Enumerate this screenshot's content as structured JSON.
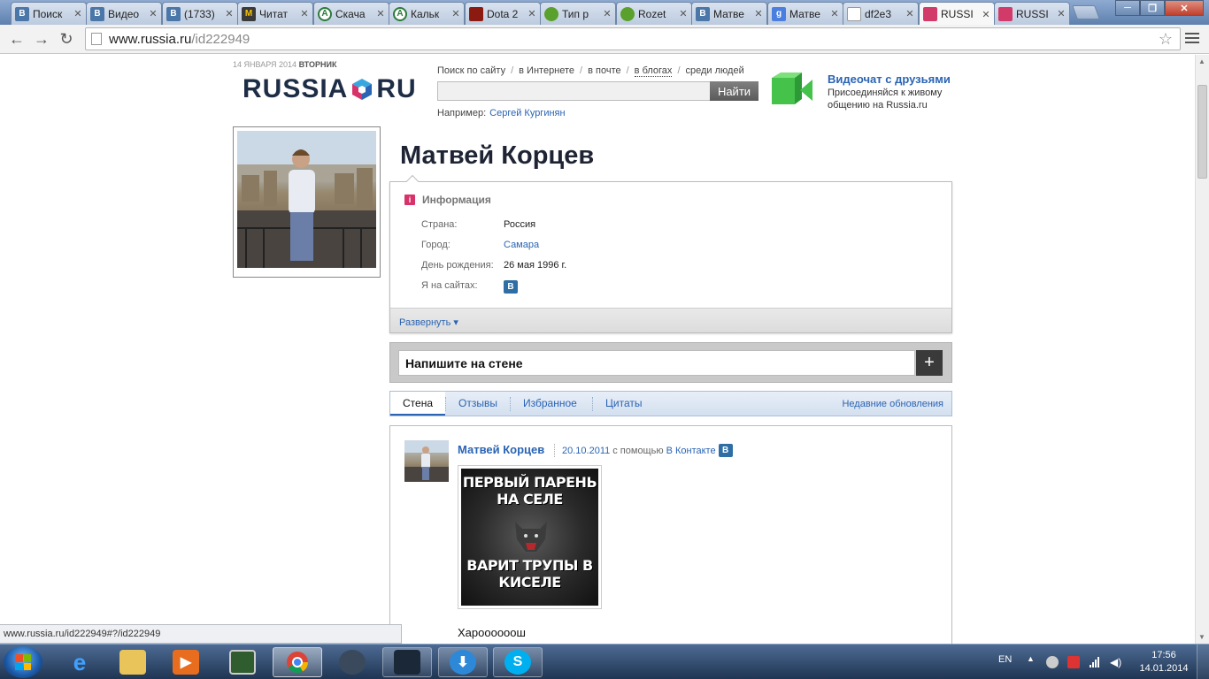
{
  "browser": {
    "tabs": [
      {
        "label": "Поиск",
        "icon": "vk-icon"
      },
      {
        "label": "Видео",
        "icon": "vk-icon"
      },
      {
        "label": "(1733)",
        "icon": "vk-icon"
      },
      {
        "label": "Читат",
        "icon": "m-icon"
      },
      {
        "label": "Скача",
        "icon": "android-icon"
      },
      {
        "label": "Кальк",
        "icon": "android-icon"
      },
      {
        "label": "Dota 2",
        "icon": "dota-icon"
      },
      {
        "label": "Тип р",
        "icon": "frog-icon"
      },
      {
        "label": "Rozet",
        "icon": "frog-icon"
      },
      {
        "label": "Матве",
        "icon": "vk-icon"
      },
      {
        "label": "Матве",
        "icon": "google-icon"
      },
      {
        "label": "df2e3",
        "icon": "document-icon"
      },
      {
        "label": "RUSSI",
        "icon": "russia-cube-icon",
        "active": true
      },
      {
        "label": "RUSSI",
        "icon": "russia-cube-icon"
      }
    ],
    "url_host": "www.russia.ru",
    "url_path": "/id222949"
  },
  "header": {
    "date_day": "14 ЯНВАРЯ 2014",
    "date_weekday": "ВТОРНИК",
    "logo_left": "RUSSIA",
    "logo_right": "RU",
    "search_scopes": [
      "Поиск  по сайту",
      "в Интернете",
      "в почте",
      "в блогах",
      "среди людей"
    ],
    "search_button": "Найти",
    "search_placeholder": "",
    "example_label": "Например:",
    "example_link": "Сергей Кургинян",
    "videochat_title": "Видеочат с друзьями",
    "videochat_desc": "Присоединяйся к живому общению на Russia.ru"
  },
  "profile": {
    "name": "Матвей Корцев",
    "info_title": "Информация",
    "rows": [
      {
        "key": "Страна:",
        "value": "Россия"
      },
      {
        "key": "Город:",
        "value": "Самара"
      },
      {
        "key": "День рождения:",
        "value": "26 мая 1996 г."
      },
      {
        "key": "Я на сайтах:",
        "value": "B"
      }
    ],
    "expand_label": "Развернуть ▾"
  },
  "wall": {
    "composer_label": "Напишите на стене",
    "plus": "+"
  },
  "tabs": {
    "items": [
      "Стена",
      "Отзывы",
      "Избранное",
      "Цитаты"
    ],
    "recent": "Недавние обновления"
  },
  "post": {
    "author": "Матвей Корцев",
    "date": "20.10.2011",
    "via": "с помощью",
    "source": "В Контакте",
    "meme_top": "ПЕРВЫЙ ПАРЕНЬ НА СЕЛЕ",
    "meme_bottom": "ВАРИТ ТРУПЫ В КИСЕЛЕ",
    "text": "Хароооооош"
  },
  "status_bar": "www.russia.ru/id222949#?/id222949",
  "taskbar": {
    "apps": [
      "internet-explorer-icon",
      "folder-icon",
      "media-player-icon",
      "task-manager-icon",
      "chrome-icon",
      "steam-app-icon",
      "steam-icon",
      "download-icon",
      "skype-icon"
    ],
    "lang": "EN",
    "time": "17:56",
    "date": "14.01.2014"
  }
}
